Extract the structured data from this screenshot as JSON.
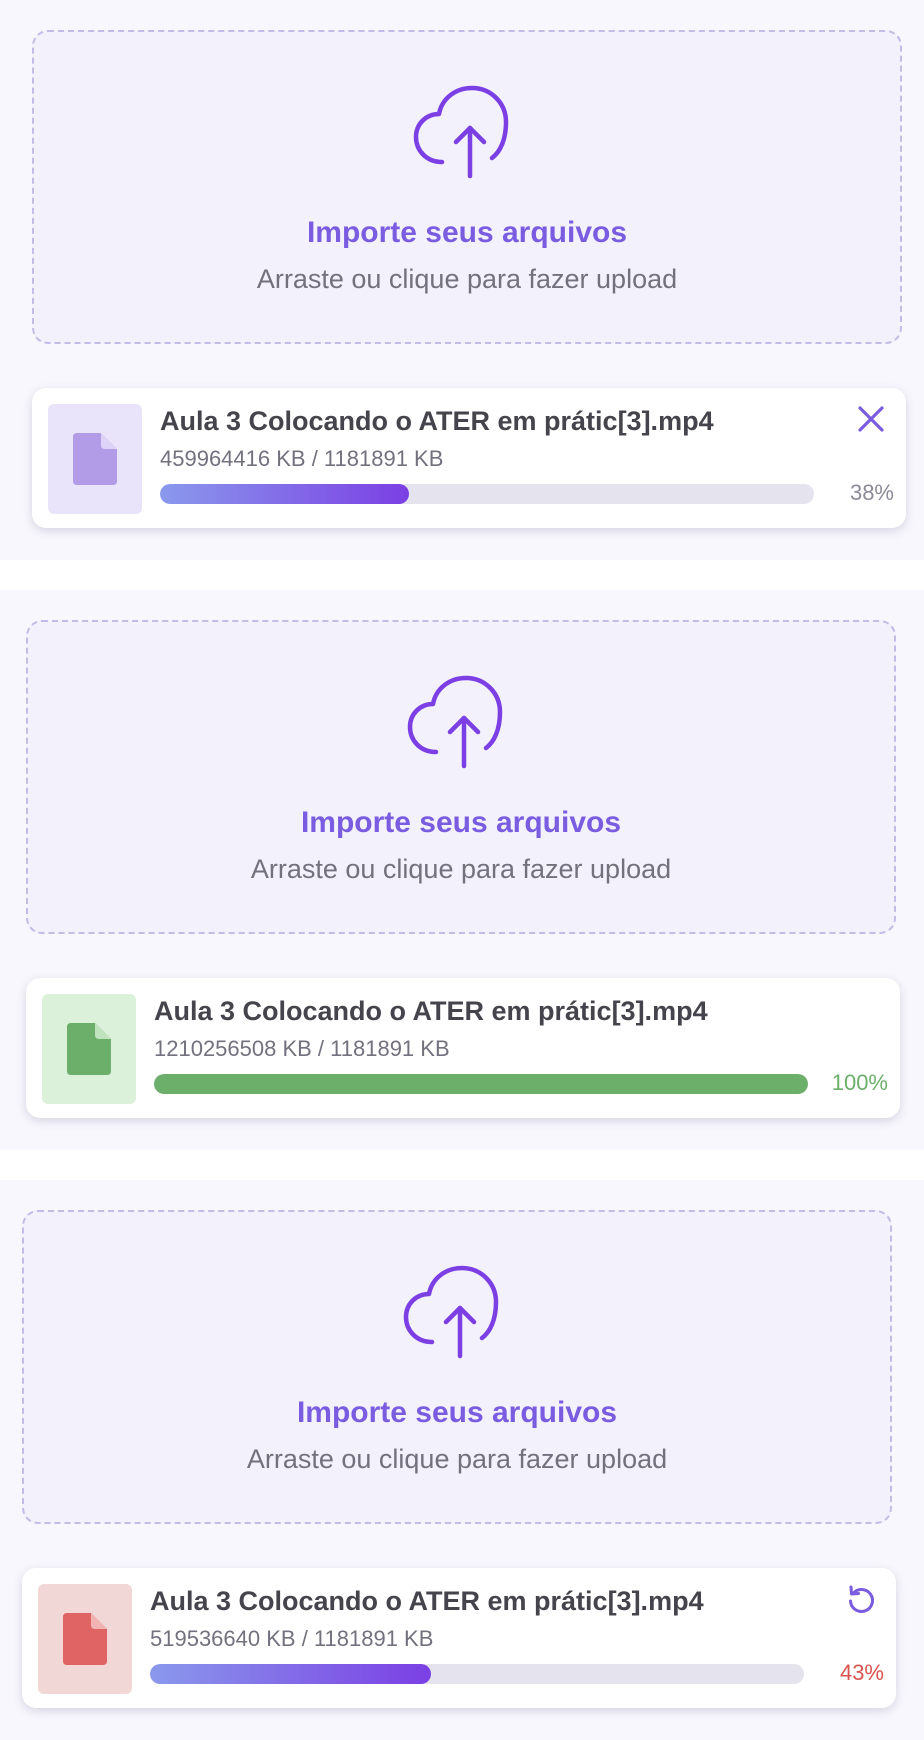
{
  "uploads": [
    {
      "dropzone": {
        "title": "Importe seus arquivos",
        "subtitle": "Arraste ou clique para fazer upload"
      },
      "file": {
        "name": "Aula 3 Colocando o ATER em prátic[3].mp4",
        "size": "459964416 KB / 1181891 KB",
        "progress_percent": 38,
        "progress_label": "38%",
        "status": "uploading",
        "action_icon": "close-icon"
      }
    },
    {
      "dropzone": {
        "title": "Importe seus arquivos",
        "subtitle": "Arraste ou clique para fazer upload"
      },
      "file": {
        "name": "Aula 3 Colocando o ATER em prátic[3].mp4",
        "size": "1210256508 KB / 1181891 KB",
        "progress_percent": 100,
        "progress_label": "100%",
        "status": "complete"
      }
    },
    {
      "dropzone": {
        "title": "Importe seus arquivos",
        "subtitle": "Arraste ou clique para fazer upload"
      },
      "file": {
        "name": "Aula 3 Colocando o ATER em prátic[3].mp4",
        "size": "519536640 KB / 1181891 KB",
        "progress_percent": 43,
        "progress_label": "43%",
        "status": "error",
        "action_icon": "retry-icon"
      }
    }
  ],
  "colors": {
    "accent": "#7a5ce0",
    "uploading_thumb_bg": "#e9e4f9",
    "uploading_doc": "#b29ce8",
    "complete_thumb_bg": "#dcf1da",
    "complete_doc": "#6caf6b",
    "complete_text": "#6caf6b",
    "error_thumb_bg": "#f2d7d7",
    "error_doc": "#e06464",
    "error_text": "#d9534f"
  }
}
